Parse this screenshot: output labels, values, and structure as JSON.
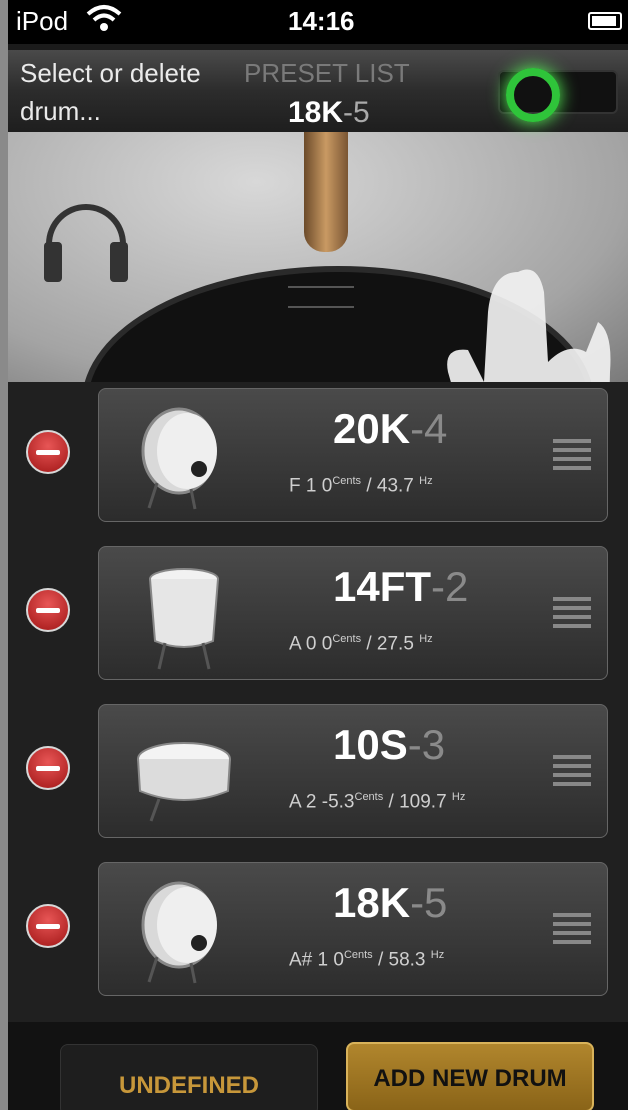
{
  "status": {
    "carrier": "iPod",
    "time": "14:16"
  },
  "header": {
    "hint_line1": "Select or delete",
    "hint_line2": "drum...",
    "preset_label": "PRESET LIST",
    "current_bold": "18K",
    "current_suffix": "-5"
  },
  "drums": [
    {
      "name_bold": "20K",
      "name_suffix": "-4",
      "note": "F 1 0",
      "cents_unit": "Cents",
      "freq": " / 43.7",
      "hz_unit": "Hz"
    },
    {
      "name_bold": "14FT",
      "name_suffix": "-2",
      "note": "A 0 0",
      "cents_unit": "Cents",
      "freq": " / 27.5",
      "hz_unit": "Hz"
    },
    {
      "name_bold": "10S",
      "name_suffix": "-3",
      "note": "A 2 -5.3",
      "cents_unit": "Cents",
      "freq": " / 109.7",
      "hz_unit": "Hz"
    },
    {
      "name_bold": "18K",
      "name_suffix": "-5",
      "note": "A# 1 0",
      "cents_unit": "Cents",
      "freq": " / 58.3",
      "hz_unit": "Hz"
    }
  ],
  "buttons": {
    "undefined_label": "UNDEFINED",
    "add_label": "ADD NEW DRUM"
  },
  "colors": {
    "accent": "#c7973a",
    "toggle_on": "#2fc43a",
    "delete": "#c02020"
  }
}
